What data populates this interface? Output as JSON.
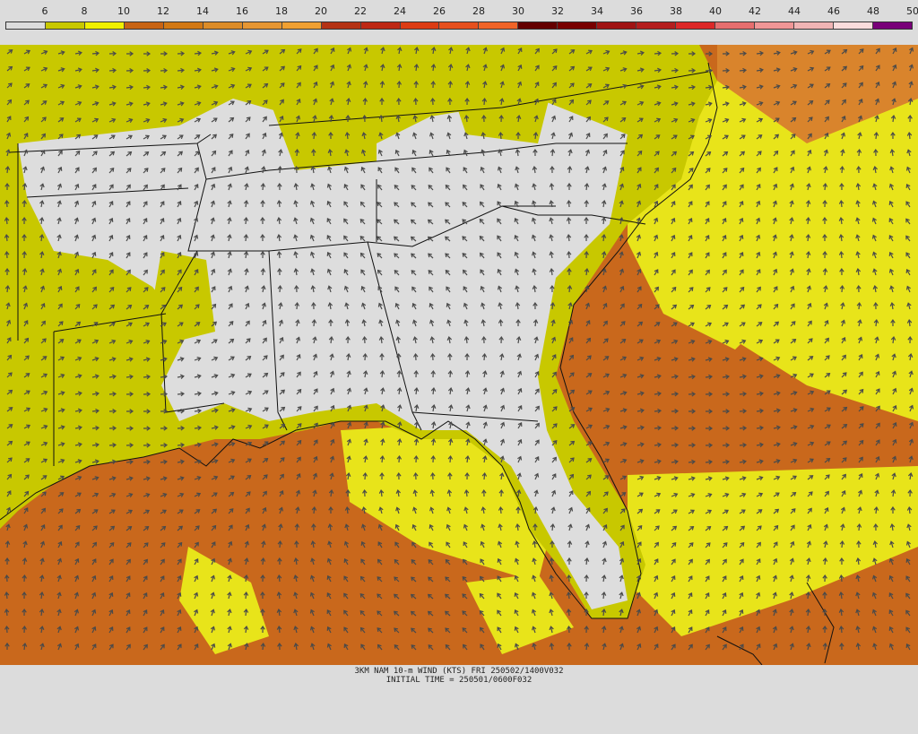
{
  "legend": {
    "labels": [
      "6",
      "8",
      "10",
      "12",
      "14",
      "16",
      "18",
      "20",
      "22",
      "24",
      "26",
      "28",
      "30",
      "32",
      "34",
      "36",
      "38",
      "40",
      "42",
      "44",
      "46",
      "48",
      "50"
    ],
    "colors": [
      "#dcdcdc",
      "#c8c800",
      "#f0f000",
      "#c86414",
      "#d27814",
      "#dc8c28",
      "#e69632",
      "#f0a032",
      "#b43214",
      "#be2814",
      "#dc3c14",
      "#e6501e",
      "#f06428",
      "#640000",
      "#780000",
      "#a01414",
      "#b41e1e",
      "#dc2828",
      "#e66e6e",
      "#f09696",
      "#f0b4b4",
      "#fadcdc",
      "#780078"
    ]
  },
  "map_colors": {
    "ocean": "#c9681c",
    "ocean_light": "#d9842c",
    "yellow": "#e8e41a",
    "olive": "#c8c800",
    "land": "#dddddd",
    "arrow": "#4a4a4a",
    "boundary": "#111111"
  },
  "footer": {
    "line1": "3KM NAM 10-m WIND (KTS) FRI 250502/1400V032",
    "line2": "INITIAL TIME = 250501/0600F032"
  }
}
